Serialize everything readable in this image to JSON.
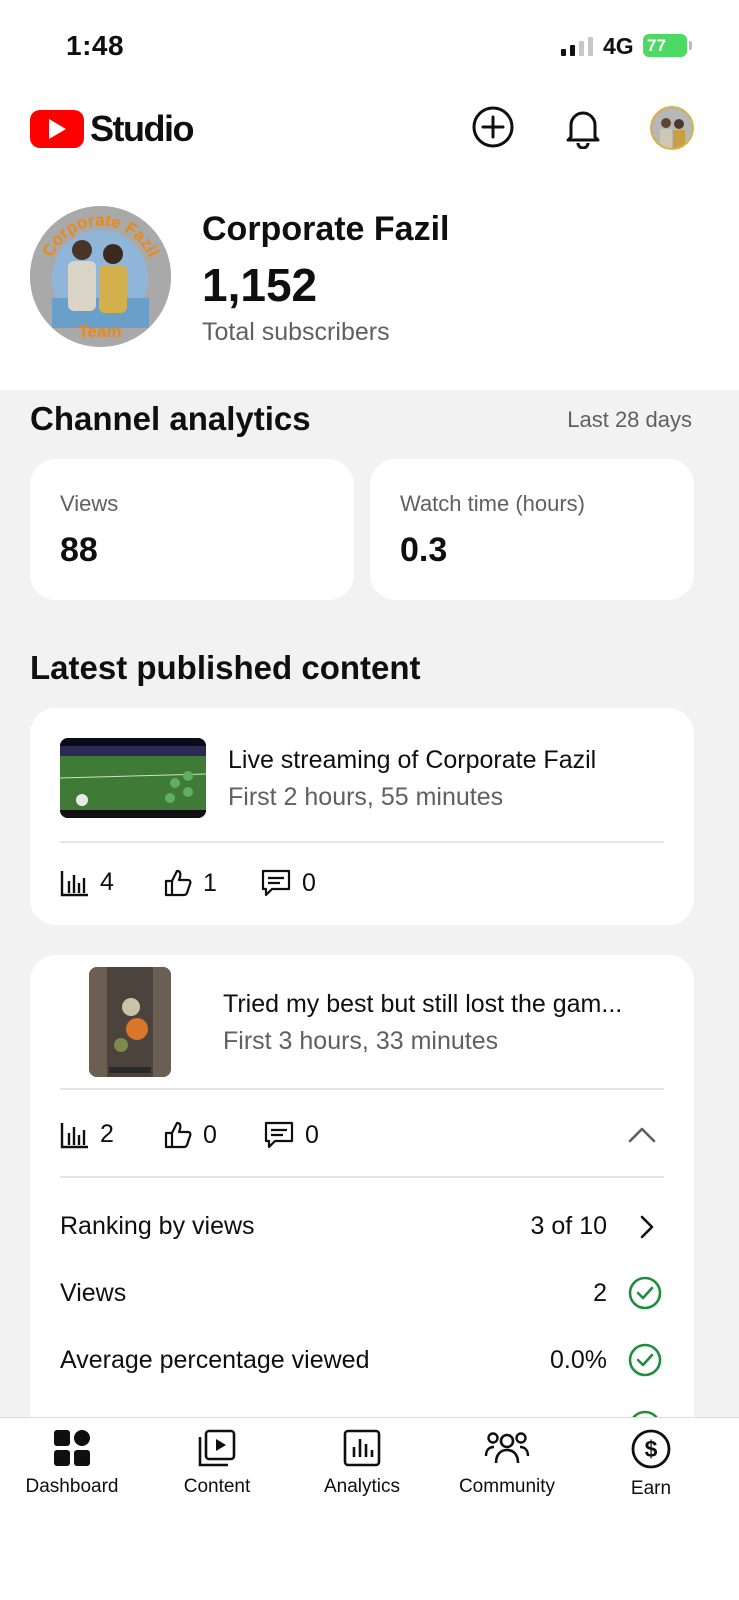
{
  "status_bar": {
    "time": "1:48",
    "network": "4G",
    "battery": "77"
  },
  "header": {
    "app_name": "Studio"
  },
  "channel": {
    "name": "Corporate Fazil",
    "subscribers": "1,152",
    "subscribers_label": "Total subscribers",
    "avatar_text": [
      "Corporate Fazil",
      "Team"
    ]
  },
  "analytics": {
    "title": "Channel analytics",
    "period": "Last 28 days",
    "views_label": "Views",
    "views_value": "88",
    "watch_label": "Watch time (hours)",
    "watch_value": "0.3"
  },
  "latest": {
    "title": "Latest published content",
    "items": [
      {
        "title": "Live streaming of Corporate Fazil",
        "subtitle": "First 2 hours, 55 minutes",
        "views": "4",
        "likes": "1",
        "comments": "0"
      },
      {
        "title": "Tried my best but still lost the gam...",
        "subtitle": "First 3 hours, 33 minutes",
        "views": "2",
        "likes": "0",
        "comments": "0",
        "details": [
          {
            "label": "Ranking by views",
            "value": "3 of 10"
          },
          {
            "label": "Views",
            "value": "2"
          },
          {
            "label": "Average percentage viewed",
            "value": "0.0%"
          }
        ]
      }
    ]
  },
  "nav": {
    "dashboard": "Dashboard",
    "content": "Content",
    "analytics": "Analytics",
    "community": "Community",
    "earn": "Earn"
  },
  "colors": {
    "brand_red": "#ff0000",
    "check_green": "#1e8e3e",
    "battery_green": "#4cd964"
  }
}
